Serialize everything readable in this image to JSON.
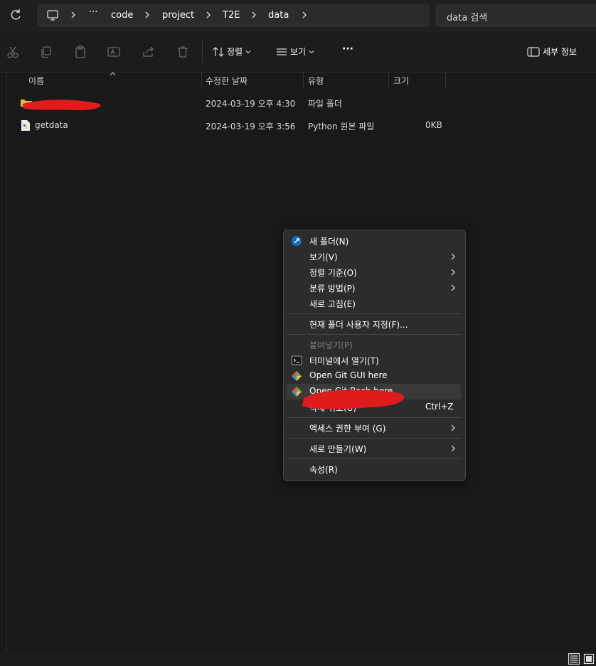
{
  "address": {
    "breadcrumbs": [
      "code",
      "project",
      "T2E",
      "data"
    ],
    "more": "···",
    "search_placeholder": "data 검색"
  },
  "toolbar": {
    "sort_label": "정렬",
    "view_label": "보기",
    "more": "···",
    "details_label": "세부 정보"
  },
  "columns": [
    "이름",
    "수정한 날짜",
    "유형",
    "크기"
  ],
  "files": [
    {
      "name": "",
      "modified": "2024-03-19 오후 4:30",
      "type": "파일 폴더",
      "size": ""
    },
    {
      "name": "getdata",
      "modified": "2024-03-19 오후 3:56",
      "type": "Python 원본 파일",
      "size": "0KB"
    }
  ],
  "context_menu": {
    "new_folder": "새 폴더(N)",
    "view": "보기(V)",
    "sort_by": "정렬 기준(O)",
    "group_by": "분류 방법(P)",
    "refresh": "새로 고침(E)",
    "customize": "현재 폴더 사용자 지정(F)...",
    "paste": "붙여넣기(P)",
    "open_terminal": "터미널에서 열기(T)",
    "git_gui": "Open Git GUI here",
    "git_bash": "Open Git Bash here",
    "undo": "삭제 취소(U)",
    "undo_shortcut": "Ctrl+Z",
    "give_access": "액세스 권한 부여 (G)",
    "new": "새로 만들기(W)",
    "properties": "속성(R)"
  },
  "colors": {
    "background": "#191919",
    "menu_bg": "#2c2c2c",
    "redaction": "#e01b1b",
    "accent": "#0f6cbd"
  }
}
